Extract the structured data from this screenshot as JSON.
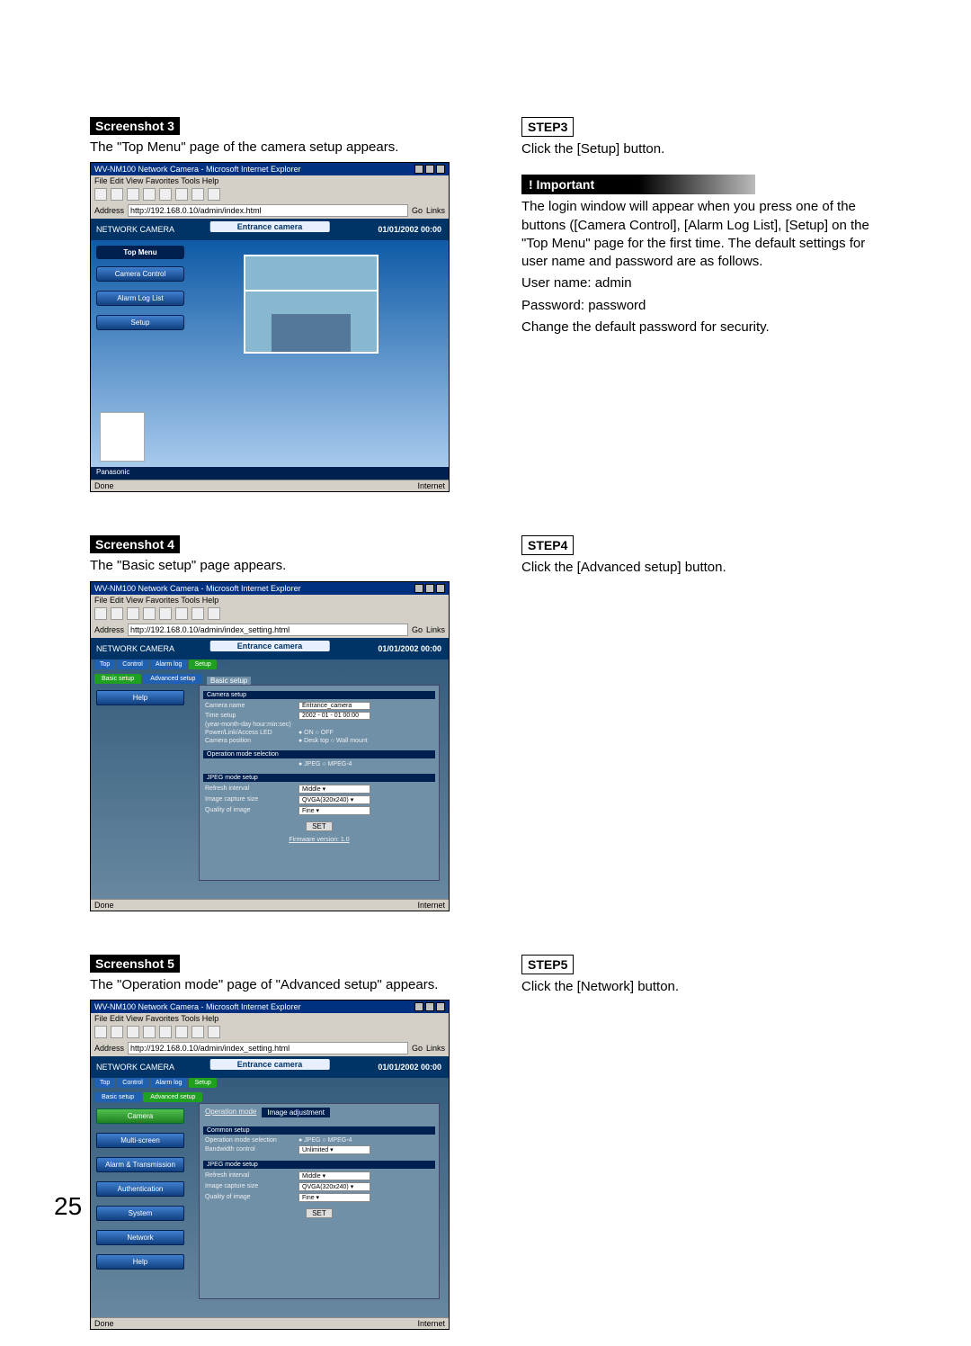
{
  "page_number": "25",
  "sections": {
    "s3": {
      "badge": "Screenshot 3",
      "caption": "The \"Top Menu\" page of the camera setup appears.",
      "step_label": "STEP3",
      "step_text": "Click the [Setup] button.",
      "important_label": "! Important",
      "important_text": "The login window will appear when you press one of the buttons ([Camera Control], [Alarm Log List], [Setup] on the \"Top Menu\" page for the first time. The default settings for user name and password are as follows.",
      "cred1": "User name: admin",
      "cred2": "Password: password",
      "cred3": "Change the default password for security."
    },
    "s4": {
      "badge": "Screenshot 4",
      "caption": "The \"Basic setup\" page appears.",
      "step_label": "STEP4",
      "step_text": "Click the [Advanced setup] button."
    },
    "s5": {
      "badge": "Screenshot 5",
      "caption": "The \"Operation mode\" page of \"Advanced setup\" appears.",
      "step_label": "STEP5",
      "step_text": "Click the [Network] button."
    }
  },
  "browser": {
    "title": "WV-NM100 Network Camera - Microsoft Internet Explorer",
    "menu": "File  Edit  View  Favorites  Tools  Help",
    "address_label": "Address",
    "url_top": "http://192.168.0.10/admin/index.html",
    "url_setup": "http://192.168.0.10/admin/index_setting.html",
    "go": "Go",
    "links": "Links",
    "status_done": "Done",
    "status_net": "Internet",
    "cam_brand": "NETWORK CAMERA",
    "cam_title": "Entrance camera",
    "cam_date": "01/01/2002 00:00",
    "brandbar": "Panasonic"
  },
  "topmenu": {
    "header": "Top Menu",
    "items": [
      "Camera Control",
      "Alarm Log List",
      "Setup"
    ]
  },
  "basic": {
    "tabs_top": [
      "Top",
      "Control",
      "Alarm log",
      "Setup"
    ],
    "tabs2": [
      "Basic setup",
      "Advanced setup"
    ],
    "help": "Help",
    "panel_title": "Basic setup",
    "section1": "Camera setup",
    "rows1": [
      {
        "lbl": "Camera name",
        "val": "Entrance_camera"
      },
      {
        "lbl": "Time setup",
        "val": "2002 - 01 - 01  00:00"
      },
      {
        "lbl": "(year-month-day hour:min:sec)",
        "val": ""
      },
      {
        "lbl": "Power/Link/Access LED",
        "val": "● ON  ○ OFF"
      },
      {
        "lbl": "Camera position",
        "val": "● Desk top  ○ Wall mount"
      }
    ],
    "section2": "Operation mode selection",
    "rows2": [
      {
        "lbl": "",
        "val": "● JPEG  ○ MPEG-4"
      }
    ],
    "section3": "JPEG mode setup",
    "rows3": [
      {
        "lbl": "Refresh interval",
        "val": "Middle ▾"
      },
      {
        "lbl": "Image capture size",
        "val": "QVGA(320x240) ▾"
      },
      {
        "lbl": "Quality of image",
        "val": "Fine ▾"
      }
    ],
    "set": "SET",
    "fw": "Firmware version: 1.0"
  },
  "adv": {
    "tabs_top": [
      "Top",
      "Control",
      "Alarm log",
      "Setup"
    ],
    "tabs2": [
      "Basic setup",
      "Advanced setup"
    ],
    "side": [
      "Camera",
      "Multi-screen",
      "Alarm & Transmission",
      "Authentication",
      "System",
      "Network",
      "Help"
    ],
    "panel_title": "Operation mode",
    "panel_tab2": "Image adjustment",
    "section1": "Common setup",
    "rows1": [
      {
        "lbl": "Operation mode selection",
        "val": "● JPEG  ○ MPEG-4"
      },
      {
        "lbl": "Bandwidth control",
        "val": "Unlimited ▾"
      }
    ],
    "section2": "JPEG mode setup",
    "rows2": [
      {
        "lbl": "Refresh interval",
        "val": "Middle ▾"
      },
      {
        "lbl": "Image capture size",
        "val": "QVGA(320x240) ▾"
      },
      {
        "lbl": "Quality of image",
        "val": "Fine ▾"
      }
    ],
    "set": "SET"
  }
}
